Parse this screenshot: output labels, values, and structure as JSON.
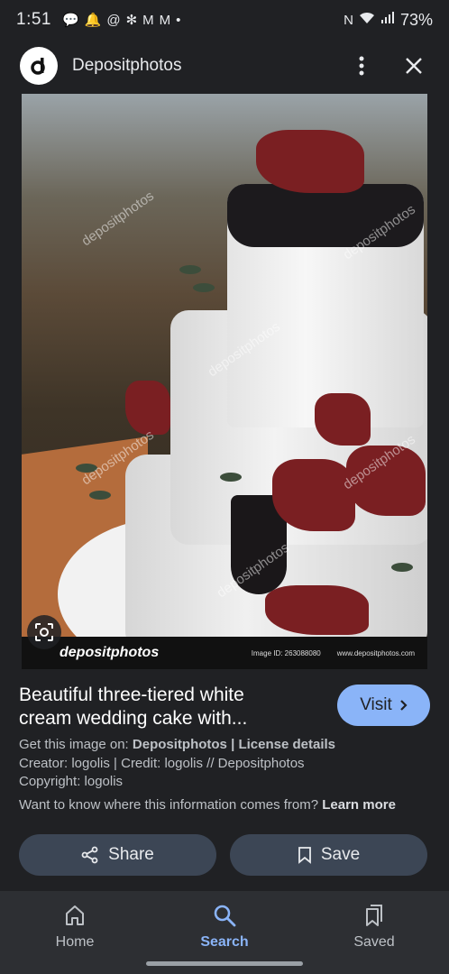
{
  "status_bar": {
    "time": "1:51",
    "battery": "73%"
  },
  "header": {
    "title": "Depositphotos"
  },
  "image": {
    "watermark": "depositphotos",
    "footer_brand": "depositphotos",
    "image_id": "Image ID: 263088080",
    "site": "www.depositphotos.com"
  },
  "info": {
    "title_line1": "Beautiful three-tiered white",
    "title_line2": "cream wedding cake with...",
    "visit_label": "Visit",
    "get_image_prefix": "Get this image on:",
    "get_image_source": "Depositphotos",
    "separator": "|",
    "license_label": "License details",
    "creator_line": "Creator: logolis | Credit: logolis // Depositphotos",
    "copyright_line": "Copyright: logolis",
    "learn_prefix": "Want to know where this information comes from?",
    "learn_more": "Learn more"
  },
  "actions": {
    "share_label": "Share",
    "save_label": "Save"
  },
  "bottom_nav": {
    "items": [
      {
        "label": "Home",
        "icon": "home-icon"
      },
      {
        "label": "Search",
        "icon": "search-icon",
        "active": true
      },
      {
        "label": "Saved",
        "icon": "bookmarks-icon"
      }
    ]
  },
  "colors": {
    "background": "#202124",
    "accent": "#8ab4f8",
    "button_bg": "#3c4655"
  }
}
